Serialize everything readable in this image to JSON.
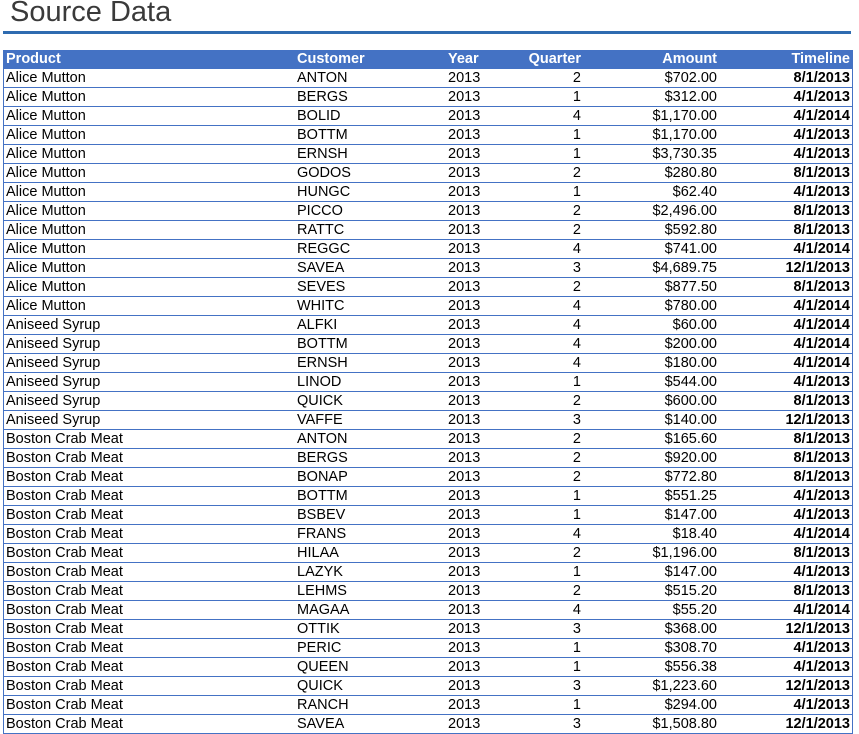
{
  "title": "Source Data",
  "columns": [
    "Product",
    "Customer",
    "Year",
    "Quarter",
    "Amount",
    "Timeline"
  ],
  "rows": [
    [
      "Alice Mutton",
      "ANTON",
      "2013",
      "2",
      "$702.00",
      "8/1/2013"
    ],
    [
      "Alice Mutton",
      "BERGS",
      "2013",
      "1",
      "$312.00",
      "4/1/2013"
    ],
    [
      "Alice Mutton",
      "BOLID",
      "2013",
      "4",
      "$1,170.00",
      "4/1/2014"
    ],
    [
      "Alice Mutton",
      "BOTTM",
      "2013",
      "1",
      "$1,170.00",
      "4/1/2013"
    ],
    [
      "Alice Mutton",
      "ERNSH",
      "2013",
      "1",
      "$3,730.35",
      "4/1/2013"
    ],
    [
      "Alice Mutton",
      "GODOS",
      "2013",
      "2",
      "$280.80",
      "8/1/2013"
    ],
    [
      "Alice Mutton",
      "HUNGC",
      "2013",
      "1",
      "$62.40",
      "4/1/2013"
    ],
    [
      "Alice Mutton",
      "PICCO",
      "2013",
      "2",
      "$2,496.00",
      "8/1/2013"
    ],
    [
      "Alice Mutton",
      "RATTC",
      "2013",
      "2",
      "$592.80",
      "8/1/2013"
    ],
    [
      "Alice Mutton",
      "REGGC",
      "2013",
      "4",
      "$741.00",
      "4/1/2014"
    ],
    [
      "Alice Mutton",
      "SAVEA",
      "2013",
      "3",
      "$4,689.75",
      "12/1/2013"
    ],
    [
      "Alice Mutton",
      "SEVES",
      "2013",
      "2",
      "$877.50",
      "8/1/2013"
    ],
    [
      "Alice Mutton",
      "WHITC",
      "2013",
      "4",
      "$780.00",
      "4/1/2014"
    ],
    [
      "Aniseed Syrup",
      "ALFKI",
      "2013",
      "4",
      "$60.00",
      "4/1/2014"
    ],
    [
      "Aniseed Syrup",
      "BOTTM",
      "2013",
      "4",
      "$200.00",
      "4/1/2014"
    ],
    [
      "Aniseed Syrup",
      "ERNSH",
      "2013",
      "4",
      "$180.00",
      "4/1/2014"
    ],
    [
      "Aniseed Syrup",
      "LINOD",
      "2013",
      "1",
      "$544.00",
      "4/1/2013"
    ],
    [
      "Aniseed Syrup",
      "QUICK",
      "2013",
      "2",
      "$600.00",
      "8/1/2013"
    ],
    [
      "Aniseed Syrup",
      "VAFFE",
      "2013",
      "3",
      "$140.00",
      "12/1/2013"
    ],
    [
      "Boston Crab Meat",
      "ANTON",
      "2013",
      "2",
      "$165.60",
      "8/1/2013"
    ],
    [
      "Boston Crab Meat",
      "BERGS",
      "2013",
      "2",
      "$920.00",
      "8/1/2013"
    ],
    [
      "Boston Crab Meat",
      "BONAP",
      "2013",
      "2",
      "$772.80",
      "8/1/2013"
    ],
    [
      "Boston Crab Meat",
      "BOTTM",
      "2013",
      "1",
      "$551.25",
      "4/1/2013"
    ],
    [
      "Boston Crab Meat",
      "BSBEV",
      "2013",
      "1",
      "$147.00",
      "4/1/2013"
    ],
    [
      "Boston Crab Meat",
      "FRANS",
      "2013",
      "4",
      "$18.40",
      "4/1/2014"
    ],
    [
      "Boston Crab Meat",
      "HILAA",
      "2013",
      "2",
      "$1,196.00",
      "8/1/2013"
    ],
    [
      "Boston Crab Meat",
      "LAZYK",
      "2013",
      "1",
      "$147.00",
      "4/1/2013"
    ],
    [
      "Boston Crab Meat",
      "LEHMS",
      "2013",
      "2",
      "$515.20",
      "8/1/2013"
    ],
    [
      "Boston Crab Meat",
      "MAGAA",
      "2013",
      "4",
      "$55.20",
      "4/1/2014"
    ],
    [
      "Boston Crab Meat",
      "OTTIK",
      "2013",
      "3",
      "$368.00",
      "12/1/2013"
    ],
    [
      "Boston Crab Meat",
      "PERIC",
      "2013",
      "1",
      "$308.70",
      "4/1/2013"
    ],
    [
      "Boston Crab Meat",
      "QUEEN",
      "2013",
      "1",
      "$556.38",
      "4/1/2013"
    ],
    [
      "Boston Crab Meat",
      "QUICK",
      "2013",
      "3",
      "$1,223.60",
      "12/1/2013"
    ],
    [
      "Boston Crab Meat",
      "RANCH",
      "2013",
      "1",
      "$294.00",
      "4/1/2013"
    ],
    [
      "Boston Crab Meat",
      "SAVEA",
      "2013",
      "3",
      "$1,508.80",
      "12/1/2013"
    ]
  ]
}
